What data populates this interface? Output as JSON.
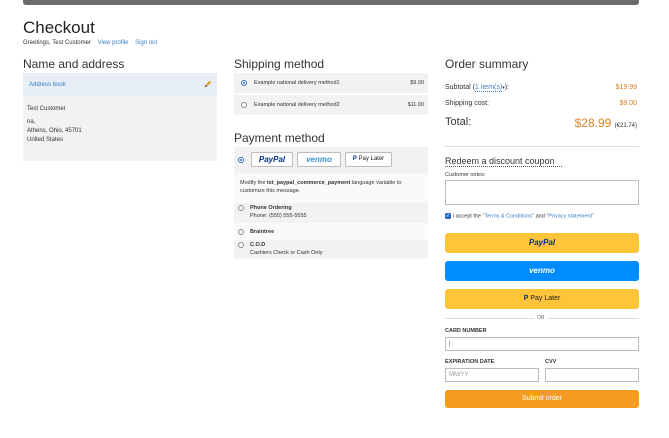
{
  "page": {
    "title": "Checkout",
    "greeting": "Greetings, Test Customer",
    "view_profile": "View profile",
    "sign_out": "Sign out"
  },
  "name_address": {
    "heading": "Name and address",
    "address_book": "Address book",
    "lines": [
      "Test Customer",
      "na,",
      "Athens, Ohio, 45701",
      "United States"
    ]
  },
  "shipping": {
    "heading": "Shipping method",
    "methods": [
      {
        "name": "Example national delivery method1",
        "price": "$9.00",
        "selected": true
      },
      {
        "name": "Example national delivery method2",
        "price": "$11.00",
        "selected": false
      }
    ]
  },
  "payment": {
    "heading": "Payment method",
    "buttons": [
      "PayPal",
      "venmo",
      "Pay Later"
    ],
    "note_prefix": "Modify the ",
    "note_bold": "txt_paypal_commerce_payment",
    "note_suffix": " language variable to customize this message.",
    "options": [
      {
        "title": "Phone Ordering",
        "sub": "Phone: (555) 555-5555"
      },
      {
        "title": "Braintree",
        "sub": ""
      },
      {
        "title": "C.O.D",
        "sub": "Cashiers Check or Cash Only"
      }
    ]
  },
  "summary": {
    "heading": "Order summary",
    "subtotal_label": "Subtotal (",
    "subtotal_items": "1 item(s)",
    "subtotal_close": "):",
    "subtotal": "$19.99",
    "shipping_label": "Shipping cost:",
    "shipping": "$9.00",
    "total_label": "Total:",
    "total": "$28.99",
    "total_alt": "(€21.74)",
    "coupon": "Redeem a discount coupon",
    "notes_label": "Customer notes:",
    "accept_prefix": "I accept the ",
    "terms": "\"Terms & Conditions\"",
    "and": " and ",
    "privacy": "\"Privacy statement\""
  },
  "checkout": {
    "paypal": "PayPal",
    "venmo": "venmo",
    "paylater": "Pay Later",
    "or": "OR",
    "card_label": "CARD NUMBER",
    "exp_label": "EXPIRATION DATE",
    "exp_placeholder": "MM/YY",
    "cvv_label": "CVV",
    "submit": "Submit order"
  },
  "colors": {
    "accent": "#3a7fc4",
    "orange": "#d9822b",
    "paypal_yellow": "#ffc439",
    "venmo_blue": "#008cff",
    "submit": "#f39c1f"
  }
}
